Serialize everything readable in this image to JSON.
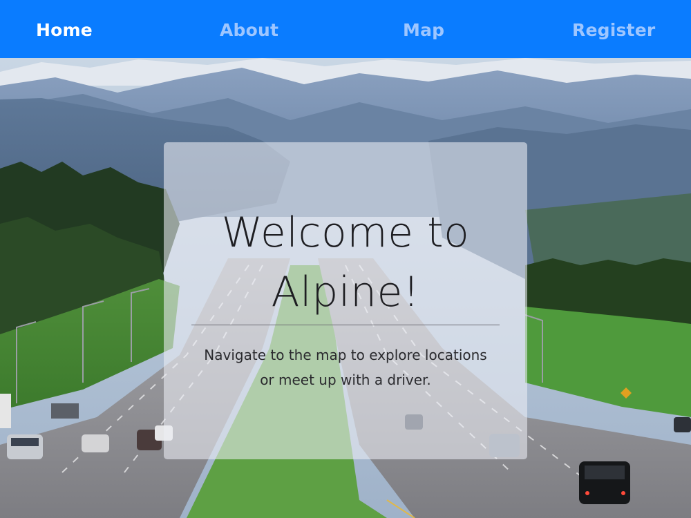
{
  "nav": {
    "items": [
      {
        "label": "Home",
        "active": true
      },
      {
        "label": "About",
        "active": false
      },
      {
        "label": "Map",
        "active": false
      },
      {
        "label": "Register",
        "active": false
      }
    ],
    "background": "#0a7cff",
    "active_color": "#ffffff",
    "inactive_color": "#9ec6ff"
  },
  "hero": {
    "title_line1": "Welcome to",
    "title_line2": "Alpine!",
    "subtitle_line1": "Navigate to the map to explore locations",
    "subtitle_line2": "or meet up with a driver."
  }
}
